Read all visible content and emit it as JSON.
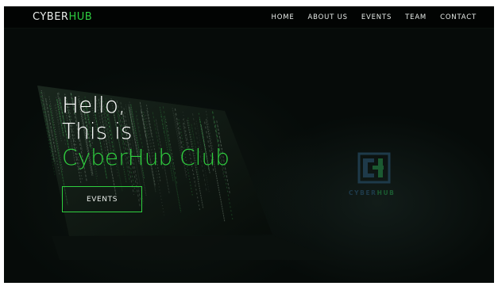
{
  "brand": {
    "prefix": "CYBER",
    "hub": "HUB"
  },
  "nav": {
    "items": [
      {
        "label": "HOME"
      },
      {
        "label": "ABOUT US"
      },
      {
        "label": "EVENTS"
      },
      {
        "label": "TEAM"
      },
      {
        "label": "CONTACT"
      }
    ]
  },
  "hero": {
    "line1": "Hello,",
    "line2": "This is",
    "line3": "CyberHub Club",
    "button_label": "EVENTS"
  },
  "badge": {
    "word_prefix": "CYBER",
    "word_hub": "HUB"
  },
  "colors": {
    "accent_green": "#2fcf3f",
    "background": "#050907",
    "badge_blue": "#1e3a4a",
    "badge_green": "#1b5a31"
  }
}
